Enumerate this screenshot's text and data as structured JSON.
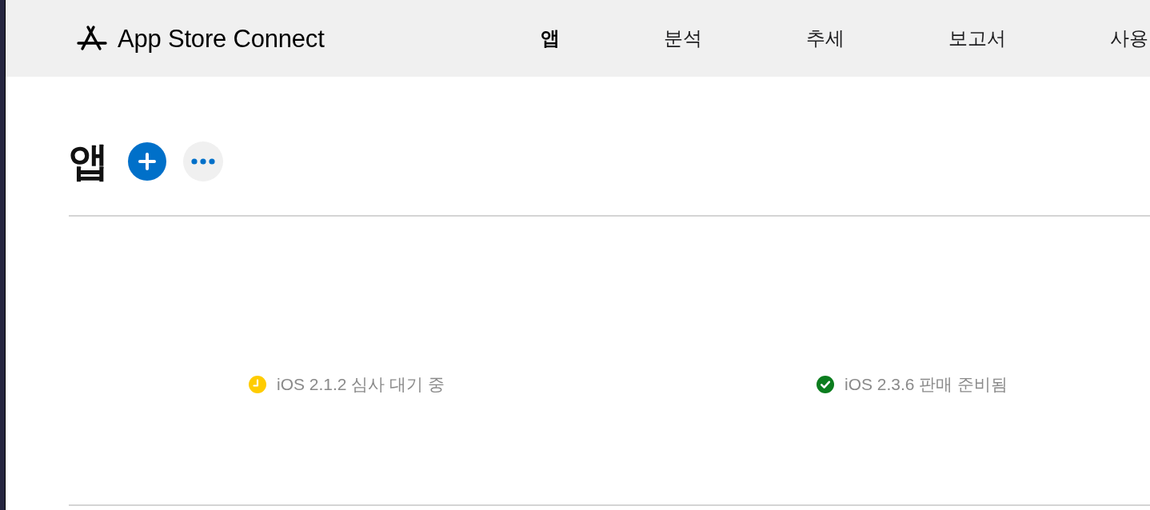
{
  "header": {
    "logo_text": "App Store Connect",
    "nav": [
      {
        "label": "앱",
        "selected": true
      },
      {
        "label": "분석",
        "selected": false
      },
      {
        "label": "추세",
        "selected": false
      },
      {
        "label": "보고서",
        "selected": false
      },
      {
        "label": "사용",
        "selected": false
      }
    ]
  },
  "page": {
    "title": "앱"
  },
  "apps": [
    {
      "status": "iOS 2.1.2 심사 대기 중",
      "kind": "waiting"
    },
    {
      "status": "iOS 2.3.6 판매 준비됨",
      "kind": "ready"
    }
  ]
}
